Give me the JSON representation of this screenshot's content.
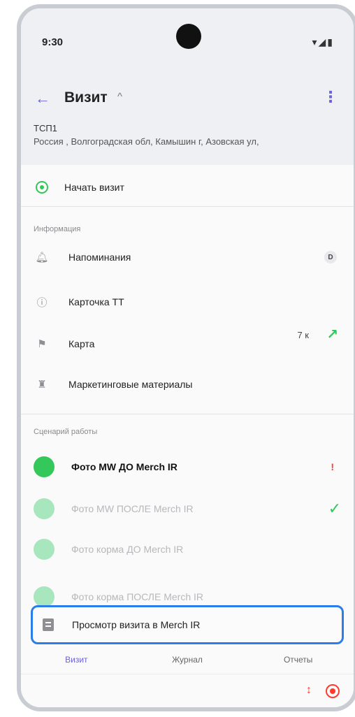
{
  "status": {
    "time": "9:30",
    "icons": "▾◢▮"
  },
  "appbar": {
    "title": "Визит",
    "chevron": "^",
    "back_icon": "arrow-left-icon",
    "menu_icon": "more-vertical-icon"
  },
  "store": {
    "name": "ТСП1",
    "address": "Россия , Волгоградская обл, Камышин г, Азовская ул,"
  },
  "start_visit": {
    "label": "Начать визит"
  },
  "info_section": {
    "title": "Информация",
    "items": [
      {
        "label": "Напоминания",
        "badge": "D"
      },
      {
        "label": "Карточка ТТ"
      },
      {
        "label": "Карта",
        "distance": "7 к",
        "arrow": "↗"
      },
      {
        "label": "Маркетинговые материалы"
      }
    ]
  },
  "scenario_section": {
    "title": "Сценарий работы",
    "steps": [
      {
        "label": "Фото MW  ДО Merch IR",
        "state": "active",
        "mark": "!"
      },
      {
        "label": "Фото MW  ПОСЛЕ Merch IR",
        "state": "faded",
        "mark": "✓"
      },
      {
        "label": "Фото корма ДО Merch IR",
        "state": "faded"
      },
      {
        "label": "Фото корма ПОСЛЕ Merch IR",
        "state": "faded"
      }
    ]
  },
  "highlight": {
    "label": "Просмотр визита в Merch IR"
  },
  "tabs": [
    {
      "label": "Визит",
      "active": true
    },
    {
      "label": "Журнал",
      "active": false
    },
    {
      "label": "Отчеты",
      "active": false
    }
  ],
  "toolbar": {
    "sort_icon": "↕"
  },
  "colors": {
    "accent": "#6b63d9",
    "green": "#34c759",
    "red": "#ff3b30",
    "highlight": "#2b7de9"
  }
}
